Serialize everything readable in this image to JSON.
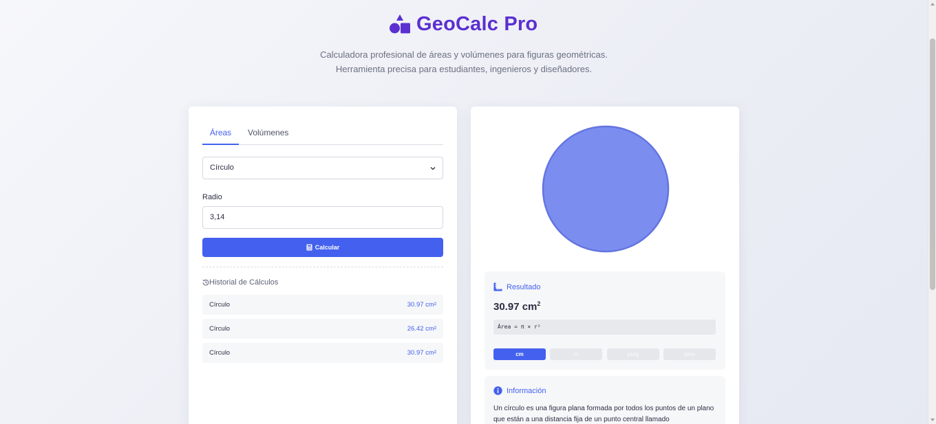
{
  "header": {
    "title": "GeoCalc Pro",
    "subtitle_line1": "Calculadora profesional de áreas y volúmenes para figuras geométricas.",
    "subtitle_line2": "Herramienta precisa para estudiantes, ingenieros y diseñadores."
  },
  "calculator": {
    "tabs": [
      {
        "label": "Áreas",
        "active": true
      },
      {
        "label": "Volúmenes",
        "active": false
      }
    ],
    "shape_select": "Círculo",
    "field_label": "Radio",
    "field_value": "3,14",
    "calc_button": "Calcular"
  },
  "history": {
    "title": "Historial de Cálculos",
    "items": [
      {
        "shape": "Círculo",
        "value": "30.97 cm²"
      },
      {
        "shape": "Círculo",
        "value": "26.42 cm²"
      },
      {
        "shape": "Círculo",
        "value": "30.97 cm²"
      }
    ]
  },
  "result": {
    "title": "Resultado",
    "value": "30.97 cm",
    "unit_exp": "2",
    "formula": "Área = π × r²",
    "units": [
      {
        "label": "cm",
        "active": true
      },
      {
        "label": "m",
        "active": false
      },
      {
        "label": "pulg",
        "active": false
      },
      {
        "label": "pies",
        "active": false
      }
    ]
  },
  "info": {
    "title": "Información",
    "text": "Un círculo es una figura plana formada por todos los puntos de un plano que están a una distancia fija de un punto central llamado"
  },
  "colors": {
    "accent": "#4361ee",
    "brand": "#5b2fd0",
    "shape_fill": "#7b8ef0",
    "shape_stroke": "#6474e0"
  },
  "icons": {
    "logo": "shapes-icon",
    "calc": "calculator-icon",
    "history": "history-icon",
    "result": "ruler-icon",
    "info": "info-circle-icon",
    "select": "chevron-down-icon"
  }
}
